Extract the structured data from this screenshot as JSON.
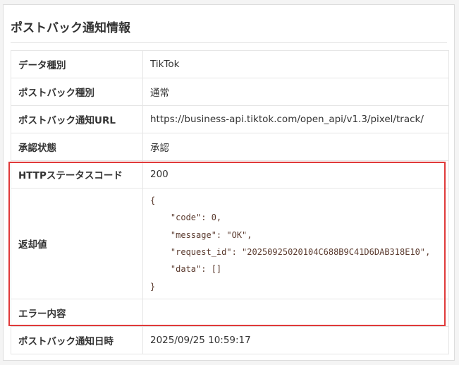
{
  "panel": {
    "title": "ポストバック通知情報"
  },
  "rows": [
    {
      "label": "データ種別",
      "value": "TikTok"
    },
    {
      "label": "ポストバック種別",
      "value": "通常"
    },
    {
      "label": "ポストバック通知URL",
      "value": "https://business-api.tiktok.com/open_api/v1.3/pixel/track/"
    },
    {
      "label": "承認状態",
      "value": "承認"
    },
    {
      "label": "HTTPステータスコード",
      "value": "200"
    },
    {
      "label": "返却値",
      "value": "{\n    \"code\": 0,\n    \"message\": \"OK\",\n    \"request_id\": \"20250925020104C688B9C41D6DAB318E10\",\n    \"data\": []\n}"
    },
    {
      "label": "エラー内容",
      "value": ""
    },
    {
      "label": "ポストバック通知日時",
      "value": "2025/09/25 10:59:17"
    }
  ],
  "highlight_color": "#e03a3a"
}
